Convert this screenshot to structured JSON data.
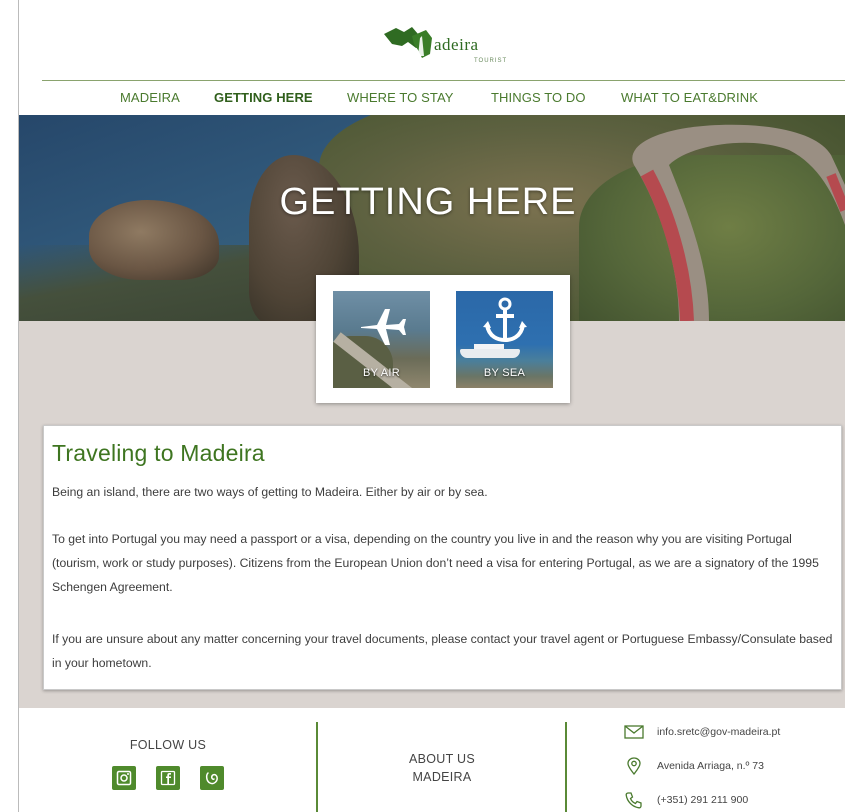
{
  "brand": {
    "name": "adeira",
    "subtitle": "TOURIST",
    "accent_color": "#4a7a2e"
  },
  "nav": {
    "items": [
      {
        "label": "MADEIRA",
        "active": false
      },
      {
        "label": "GETTING HERE",
        "active": true
      },
      {
        "label": "WHERE TO STAY",
        "active": false
      },
      {
        "label": "THINGS TO DO",
        "active": false
      },
      {
        "label": "WHAT TO EAT&DRINK",
        "active": false
      }
    ]
  },
  "hero": {
    "title": "GETTING HERE"
  },
  "transport": {
    "options": [
      {
        "label": "BY AIR",
        "icon": "airplane-icon"
      },
      {
        "label": "BY SEA",
        "icon": "anchor-icon"
      }
    ]
  },
  "info": {
    "title": "Traveling to Madeira",
    "paragraphs": [
      "Being an island, there are two ways of getting to Madeira. Either by air or by sea.",
      "To get into Portugal you may need a passport or a visa, depending on the country you live in and the reason why you are visiting Portugal (tourism, work or study purposes). Citizens from the European Union don’t need a visa for entering Portugal, as we are a signatory of the 1995 Schengen Agreement.",
      "If you are unsure about any matter concerning your travel documents, please contact your travel agent or Portuguese Embassy/Consulate based in your hometown."
    ]
  },
  "footer": {
    "follow_title": "FOLLOW US",
    "social": [
      "instagram-icon",
      "facebook-icon",
      "tripadvisor-icon"
    ],
    "about_line1": "ABOUT US",
    "about_line2": "MADEIRA",
    "email": "info.sretc@gov-madeira.pt",
    "address": "Avenida Arriaga, n.º 73",
    "phone": "(+351) 291 211 900"
  }
}
